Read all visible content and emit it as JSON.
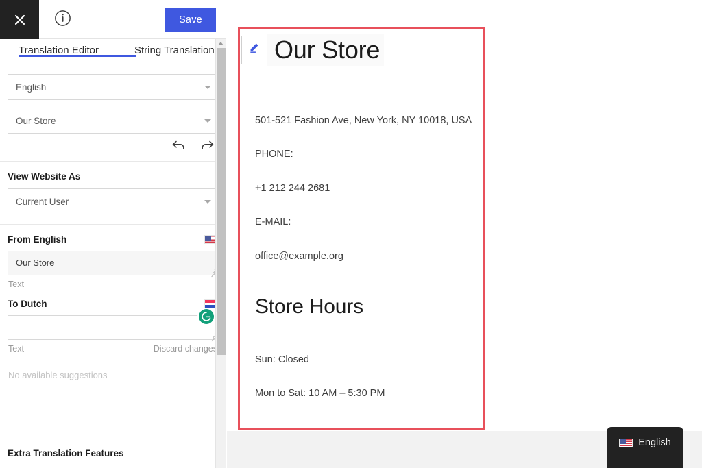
{
  "topbar": {
    "close_icon": "close-icon",
    "info_icon": "info-icon",
    "save_label": "Save"
  },
  "tabs": [
    {
      "label": "Translation Editor",
      "active": true
    },
    {
      "label": "String Translation",
      "active": false
    }
  ],
  "sidebar": {
    "language_select": {
      "value": "English",
      "caret_icon": "chevron-down-icon"
    },
    "string_select": {
      "value": "Our Store",
      "caret_icon": "chevron-down-icon"
    },
    "undo_icon": "undo-arrow-icon",
    "redo_icon": "redo-arrow-icon",
    "view_website_as": {
      "title": "View Website As",
      "select_value": "Current User",
      "caret_icon": "chevron-down-icon"
    },
    "source": {
      "label": "From English",
      "flag_icon": "flag-us-icon",
      "value": "Our Store",
      "field_type_label": "Text"
    },
    "target": {
      "label": "To Dutch",
      "flag_icon": "flag-nl-icon",
      "value": "",
      "placeholder": "",
      "field_type_label": "Text",
      "discard_label": "Discard changes",
      "grammarly_icon": "grammarly-icon",
      "grammarly_glyph": "G"
    },
    "suggestions_empty": "No available suggestions",
    "extra_features_title": "Extra Translation Features",
    "scrollbar": {
      "up_arrow_icon": "scroll-up-arrow-icon"
    }
  },
  "preview": {
    "edit_icon": "pencil-icon",
    "page_title": "Our Store",
    "lines": [
      "501-521 Fashion Ave, New York, NY 10018, USA",
      "PHONE:",
      "+1 212 244 2681",
      "E-MAIL:",
      "office@example.org"
    ],
    "hours_title": "Store Hours",
    "hours": [
      "Sun: Closed",
      "Mon to Sat: 10 AM – 5:30 PM"
    ],
    "language_switcher": {
      "label": "English",
      "flag_icon": "flag-us-icon"
    },
    "highlight_color": "#e8505b"
  }
}
